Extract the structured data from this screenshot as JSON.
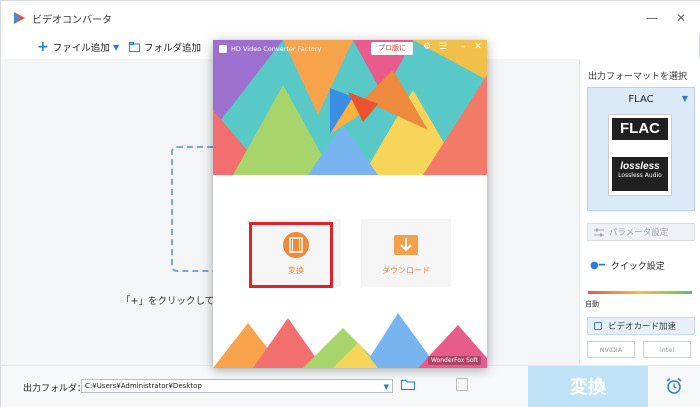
{
  "window": {
    "title": "ビデオコンバータ",
    "minimize": "—",
    "close": "✕"
  },
  "toolbar": {
    "add_file": "ファイル追加",
    "add_folder": "フォルダ追加"
  },
  "main": {
    "hint": "「+」をクリックしてファ"
  },
  "right_panel": {
    "output_format_label": "出力フォーマットを選択",
    "format_name": "FLAC",
    "format_card_top": "FLAC",
    "format_card_lossless": "lossless",
    "format_card_audio": "Lossless Audio",
    "param_button": "パラメータ設定",
    "quick_setting": "クイック設定",
    "slider_label": "自動",
    "gpu_button": "ビデオカード加速",
    "vendors": [
      "NVIDIA",
      "intel"
    ]
  },
  "bottom": {
    "output_folder_label": "出力フォルダ：",
    "output_path": "C:¥Users¥Administrator¥Desktop",
    "convert_button": "変換"
  },
  "popup": {
    "title": "HD Video Converter Factory",
    "pro_button": "プロ版に",
    "tiles": [
      {
        "label": "変換"
      },
      {
        "label": "ダウンロード"
      }
    ],
    "brand": "WonderFox Soft"
  },
  "colors": {
    "accent": "#2a7bd6",
    "highlight": "#e0232a",
    "tile_text": "#e8833a",
    "convert_button_bg": "#bfe2f7"
  }
}
